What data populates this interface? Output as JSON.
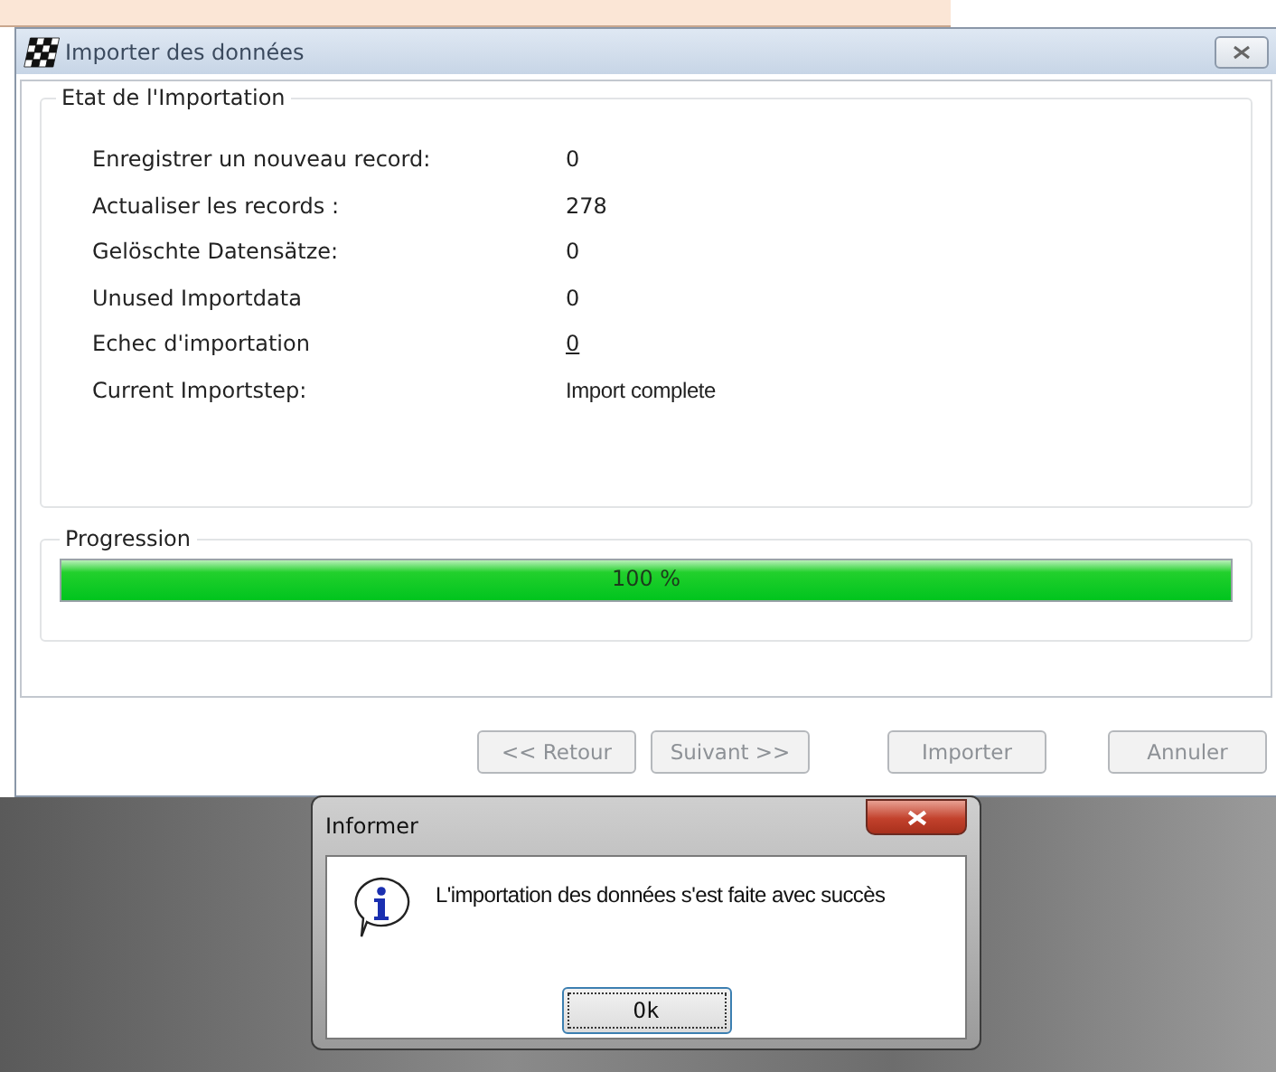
{
  "window": {
    "title": "Importer des données"
  },
  "status_group": {
    "title": "Etat de l'Importation",
    "rows": [
      {
        "label": "Enregistrer un nouveau record:",
        "value": "0",
        "kind": "text"
      },
      {
        "label": "Actualiser les records :",
        "value": "278",
        "kind": "text"
      },
      {
        "label": "Gelöschte Datensätze:",
        "value": "0",
        "kind": "text"
      },
      {
        "label": "Unused Importdata",
        "value": "0",
        "kind": "text"
      },
      {
        "label": "Echec d'importation",
        "value": "0",
        "kind": "link"
      },
      {
        "label": "Current Importstep:",
        "value": "Import complete",
        "kind": "status"
      }
    ]
  },
  "progress_group": {
    "title": "Progression",
    "level": 1,
    "reading": "100 %"
  },
  "buttons": [
    {
      "label": "<< Retour",
      "disabled": true
    },
    {
      "label": "Suivant >>",
      "disabled": true
    },
    {
      "label": "Importer",
      "disabled": true
    },
    {
      "label": "Annuler",
      "disabled": true
    }
  ],
  "dialog": {
    "title": "Informer",
    "message": "L'importation des données s'est faite avec succès",
    "button": "Ok"
  }
}
